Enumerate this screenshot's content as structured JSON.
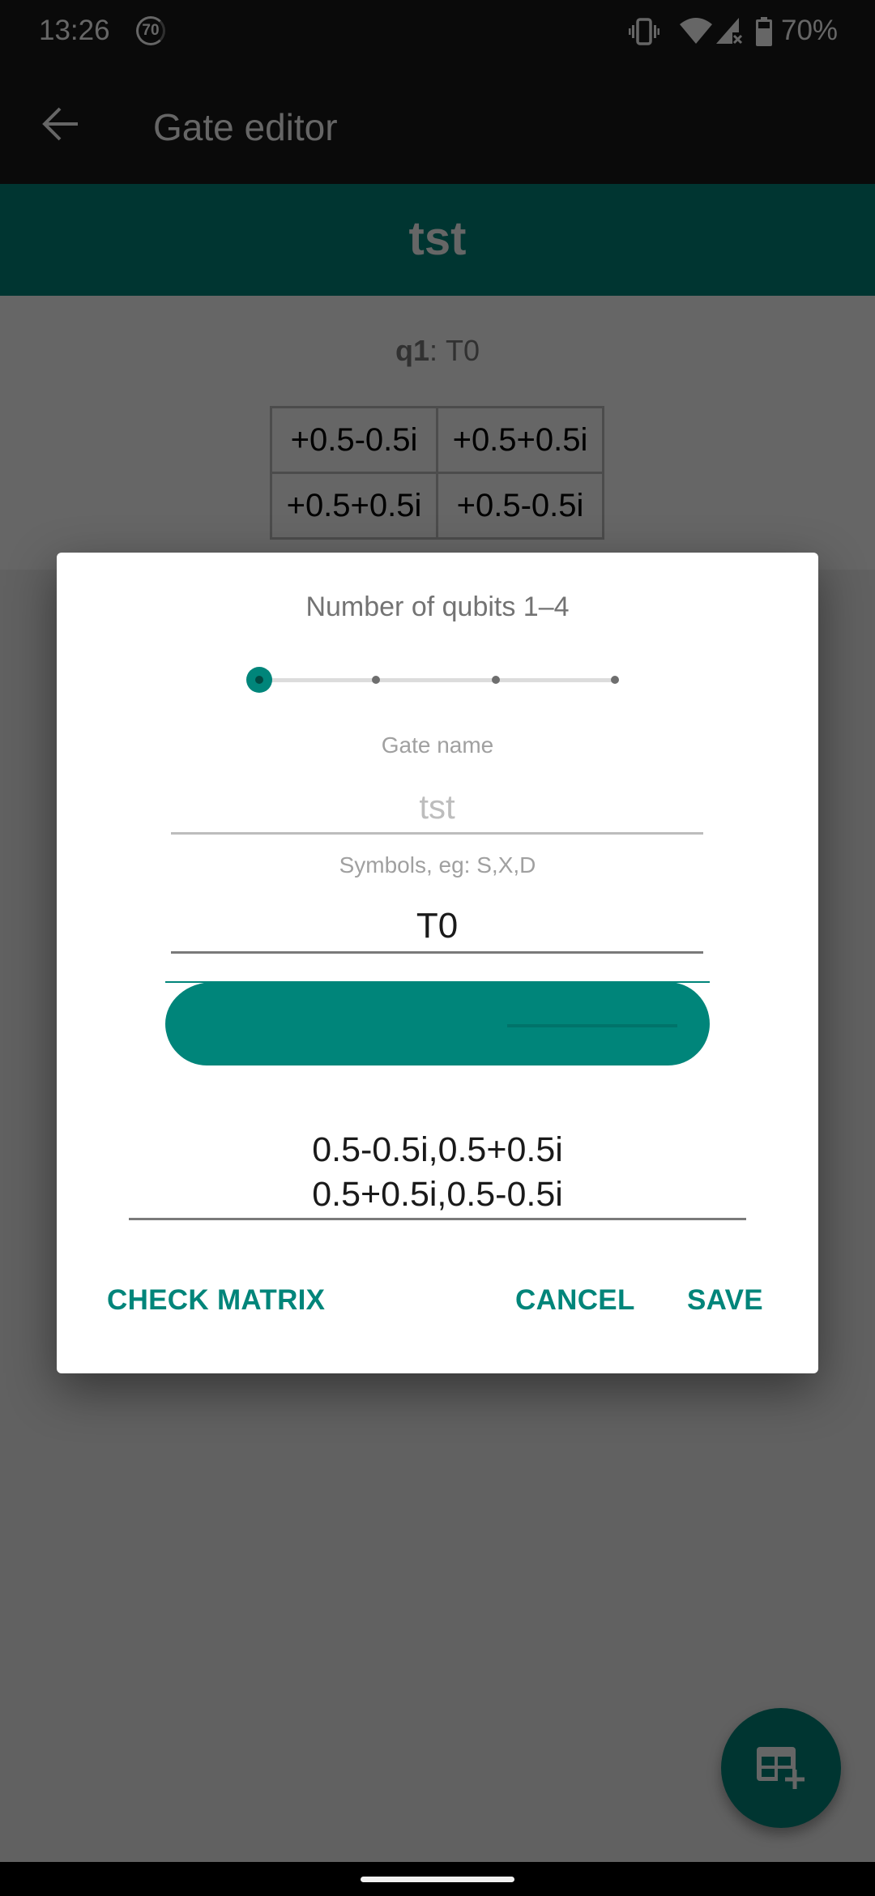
{
  "status_bar": {
    "time": "13:26",
    "notification_badge": "70",
    "battery_percent": "70%",
    "icons": [
      "vibrate-icon",
      "wifi-icon",
      "cell-signal-no-service-icon",
      "battery-icon"
    ]
  },
  "app_bar": {
    "back_icon": "arrow-back-icon",
    "title": "Gate editor"
  },
  "gate_view": {
    "name": "tst",
    "qubit_label": "q1",
    "qubit_separator": ":",
    "qubit_symbol": "T0",
    "matrix": [
      [
        "+0.5-0.5i",
        "+0.5+0.5i"
      ],
      [
        "+0.5+0.5i",
        "+0.5-0.5i"
      ]
    ]
  },
  "fab": {
    "icon": "table-add-icon"
  },
  "dialog": {
    "qubits_label": "Number of qubits 1–4",
    "qubits_slider": {
      "min": 1,
      "max": 4,
      "value": 1,
      "steps": [
        1,
        2,
        3,
        4
      ]
    },
    "gate_name_label": "Gate name",
    "gate_name_value": "",
    "gate_name_placeholder": "tst",
    "symbols_label": "Symbols, eg: S,X,D",
    "symbols_value": "T0",
    "matrix_value": "0.5-0.5i,0.5+0.5i\n0.5+0.5i,0.5-0.5i",
    "buttons": {
      "check_matrix": "CHECK MATRIX",
      "cancel": "CANCEL",
      "save": "SAVE"
    }
  },
  "colors": {
    "accent": "#00857a",
    "scrim": "rgba(0,0,0,0.6)"
  }
}
